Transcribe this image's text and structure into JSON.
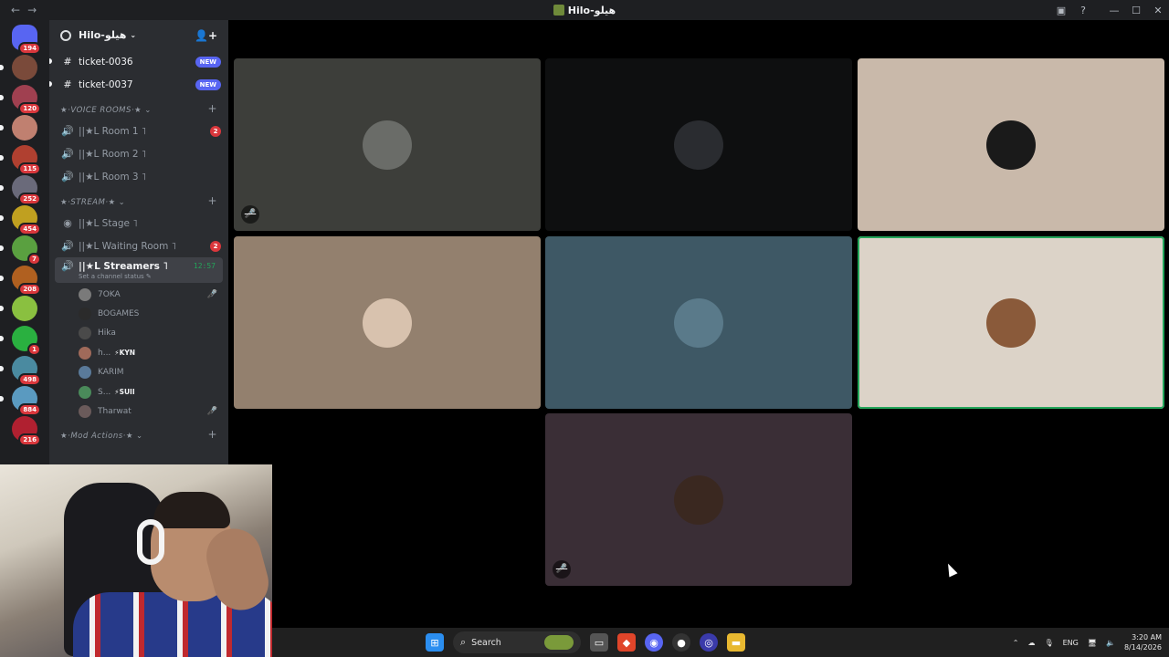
{
  "window": {
    "title": "Hilo-هيلو",
    "back": "←",
    "forward": "→"
  },
  "guilds": [
    {
      "color": "#5865f2",
      "badge": "194"
    },
    {
      "color": "#7a4a3a",
      "badge": ""
    },
    {
      "color": "#a04050",
      "badge": "120"
    },
    {
      "color": "#c08070",
      "badge": ""
    },
    {
      "color": "#b04030",
      "badge": "115"
    },
    {
      "color": "#6a6a7a",
      "badge": "252"
    },
    {
      "color": "#c0a020",
      "badge": "454"
    },
    {
      "color": "#5aa040",
      "badge": "7"
    },
    {
      "color": "#b06020",
      "badge": "208"
    },
    {
      "color": "#8ac040",
      "badge": ""
    },
    {
      "color": "#2ab040",
      "badge": "1"
    },
    {
      "color": "#4a8aa0",
      "badge": "498"
    },
    {
      "color": "#5a9ac0",
      "badge": "884"
    },
    {
      "color": "#b02030",
      "badge": "216"
    }
  ],
  "server": {
    "name": "Hilo-هيلو"
  },
  "channels": {
    "text": [
      {
        "name": "ticket-0036",
        "badge": "NEW"
      },
      {
        "name": "ticket-0037",
        "badge": "NEW"
      }
    ],
    "voice_category": "★·VOICE ROOMS·★",
    "voice": [
      {
        "name": "||★L Room 1 ˥",
        "count": "2"
      },
      {
        "name": "||★L Room 2 ˥",
        "count": ""
      },
      {
        "name": "||★L Room 3 ˥",
        "count": ""
      }
    ],
    "stream_category": "★·STREAM·★",
    "stream": [
      {
        "name": "||★L Stage ˥",
        "count": ""
      },
      {
        "name": "||★L Waiting Room ˥",
        "count": "2"
      }
    ],
    "active": {
      "name": "||★L Streamers ˥",
      "time": "12:57",
      "status": "Set a channel status"
    },
    "mod_category": "★·Mod Actions·★"
  },
  "members": [
    {
      "name": "7OKA",
      "tag": "",
      "muted": true,
      "color": "#7a7a7a"
    },
    {
      "name": "BOGAMES",
      "tag": "",
      "muted": false,
      "color": "#2b2b2b"
    },
    {
      "name": "Hika",
      "tag": "",
      "muted": false,
      "color": "#4a4a4a"
    },
    {
      "name": "h...",
      "tag": "⚡KYN",
      "muted": false,
      "color": "#a06a5a"
    },
    {
      "name": "KARIM",
      "tag": "",
      "muted": false,
      "color": "#5a7a9a"
    },
    {
      "name": "S...",
      "tag": "⚡SUII",
      "muted": false,
      "color": "#4a8a5a"
    },
    {
      "name": "Tharwat",
      "tag": "",
      "muted": true,
      "color": "#6a5a5a"
    }
  ],
  "tiles": [
    {
      "bg": "#3d3e3a",
      "avatar": "#6a6c68",
      "muted": true,
      "speaking": false
    },
    {
      "bg": "#0e0f10",
      "avatar": "#2a2c30",
      "muted": false,
      "speaking": false
    },
    {
      "bg": "#c9b9aa",
      "avatar": "#1a1a1a",
      "muted": false,
      "speaking": false
    },
    {
      "bg": "#93806e",
      "avatar": "#d8c2ae",
      "muted": false,
      "speaking": false
    },
    {
      "bg": "#3e5865",
      "avatar": "#5a7a8a",
      "muted": false,
      "speaking": false
    },
    {
      "bg": "#dcd3c8",
      "avatar": "#8a5a3a",
      "muted": false,
      "speaking": true
    },
    {
      "bg": "#3a2e36",
      "avatar": "#3a2820",
      "muted": true,
      "speaking": false
    }
  ],
  "taskbar": {
    "search_label": "Search",
    "language": "ENG",
    "time": "3:20 AM",
    "date": "8/14/2026"
  }
}
